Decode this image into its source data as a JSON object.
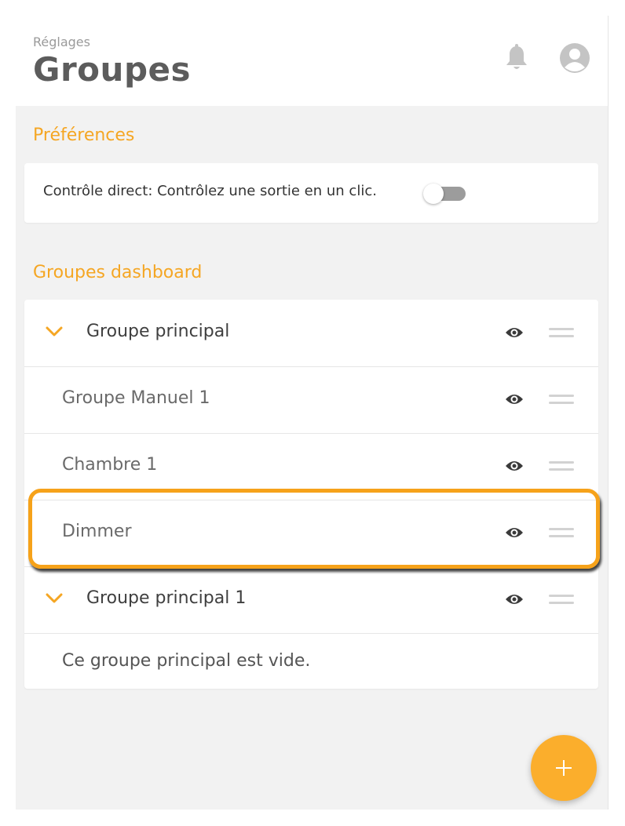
{
  "header": {
    "subtitle": "Réglages",
    "title": "Groupes"
  },
  "preferences": {
    "section_title": "Préférences",
    "direct_control_label": "Contrôle direct: Contrôlez une sortie en un clic.",
    "direct_control_enabled": false
  },
  "dashboard": {
    "section_title": "Groupes dashboard",
    "rows": [
      {
        "label": "Groupe principal",
        "type": "main"
      },
      {
        "label": "Groupe Manuel 1",
        "type": "sub"
      },
      {
        "label": "Chambre 1",
        "type": "sub"
      },
      {
        "label": "Dimmer",
        "type": "sub",
        "highlighted": true
      },
      {
        "label": "Groupe principal 1",
        "type": "main"
      }
    ],
    "empty_message": "Ce groupe principal est vide."
  },
  "icons": {
    "notifications": "bell-icon",
    "account": "avatar-icon",
    "expand": "chevron-down-icon",
    "visibility": "eye-icon",
    "reorder": "drag-handle-icon",
    "add": "plus-icon"
  },
  "colors": {
    "accent": "#f5a623",
    "fab": "#fbae2c",
    "highlight": "#f6a21a"
  }
}
